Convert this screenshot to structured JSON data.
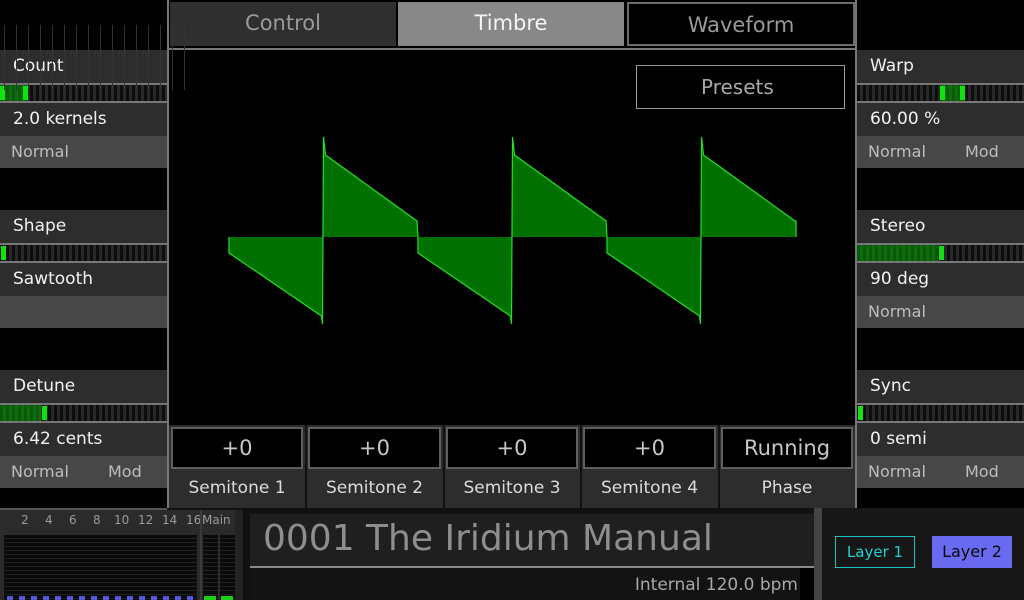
{
  "tabs": [
    {
      "label": "Control",
      "active": false
    },
    {
      "label": "Timbre",
      "active": true
    },
    {
      "label": "Waveform",
      "active": false
    }
  ],
  "presets_label": "Presets",
  "left_params": [
    {
      "title": "Count",
      "value": "2.0 kernels",
      "mode": "Normal",
      "mod": "",
      "level": 0.13,
      "marker_style": "range"
    },
    {
      "title": "Shape",
      "value": "Sawtooth",
      "mode": "",
      "mod": "",
      "level": 0.0,
      "marker_style": "single"
    },
    {
      "title": "Detune",
      "value": "6.42 cents",
      "mode": "Normal",
      "mod": "Mod",
      "level": 0.25,
      "marker_style": "single"
    }
  ],
  "right_params": [
    {
      "title": "Warp",
      "value": "60.00 %",
      "mode": "Normal",
      "mod": "Mod",
      "level": 0.6,
      "marker_style": "range"
    },
    {
      "title": "Stereo",
      "value": "90 deg",
      "mode": "Normal",
      "mod": "",
      "level": 0.5,
      "marker_style": "single"
    },
    {
      "title": "Sync",
      "value": "0 semi",
      "mode": "Normal",
      "mod": "Mod",
      "level": 0.0,
      "marker_style": "single"
    }
  ],
  "semitones": [
    {
      "value": "+0",
      "label": "Semitone 1"
    },
    {
      "value": "+0",
      "label": "Semitone 2"
    },
    {
      "value": "+0",
      "label": "Semitone 3"
    },
    {
      "value": "+0",
      "label": "Semitone 4"
    },
    {
      "value": "Running",
      "label": "Phase"
    }
  ],
  "mixer": {
    "channel_labels": [
      "2",
      "4",
      "6",
      "8",
      "10",
      "12",
      "14",
      "16"
    ],
    "main_label": "Main",
    "channel_count": 16
  },
  "patch_name": "0001 The Iridium Manual",
  "tempo": "Internal 120.0 bpm",
  "layers": [
    {
      "label": "Layer 1",
      "active": false
    },
    {
      "label": "Layer 2",
      "active": true
    }
  ],
  "waveform": {
    "type": "sawtooth",
    "kernels": 2,
    "cycles": 3,
    "color_fill": "#007000",
    "color_line": "#22e022"
  },
  "colors": {
    "accent_green": "#11e011",
    "layer_active": "#6a6af0",
    "layer_inactive": "#20d0d0"
  }
}
